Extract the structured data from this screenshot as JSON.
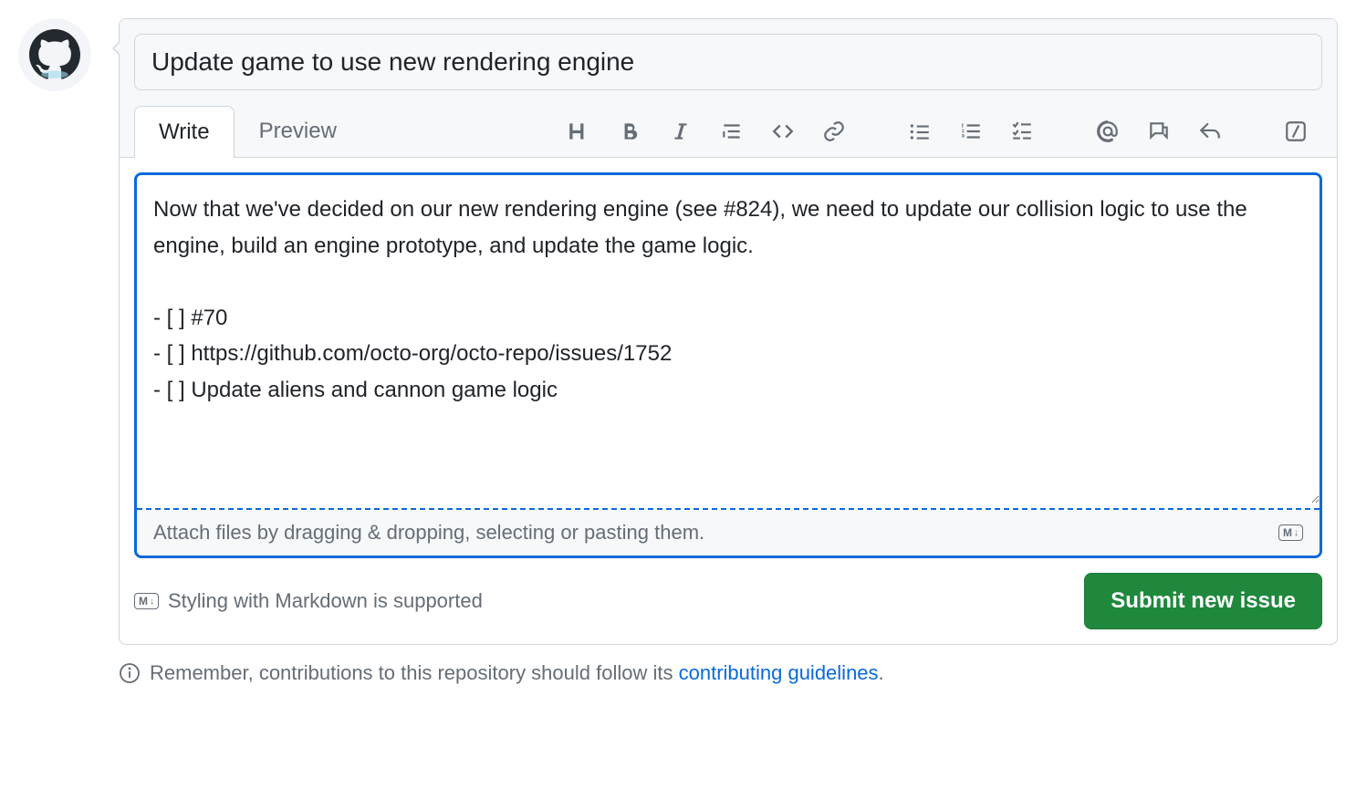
{
  "issue": {
    "title": "Update game to use new rendering engine",
    "body": "Now that we've decided on our new rendering engine (see #824), we need to update our collision logic to use the engine, build an engine prototype, and update the game logic.\n\n- [ ] #70\n- [ ] https://github.com/octo-org/octo-repo/issues/1752\n- [ ] Update aliens and cannon game logic"
  },
  "tabs": {
    "write": "Write",
    "preview": "Preview"
  },
  "attach_hint": "Attach files by dragging & dropping, selecting or pasting them.",
  "styling_note": "Styling with Markdown is supported",
  "submit_label": "Submit new issue",
  "contrib": {
    "prefix": "Remember, contributions to this repository should follow its ",
    "link_text": "contributing guidelines",
    "suffix": "."
  },
  "md_badge": "M↓"
}
